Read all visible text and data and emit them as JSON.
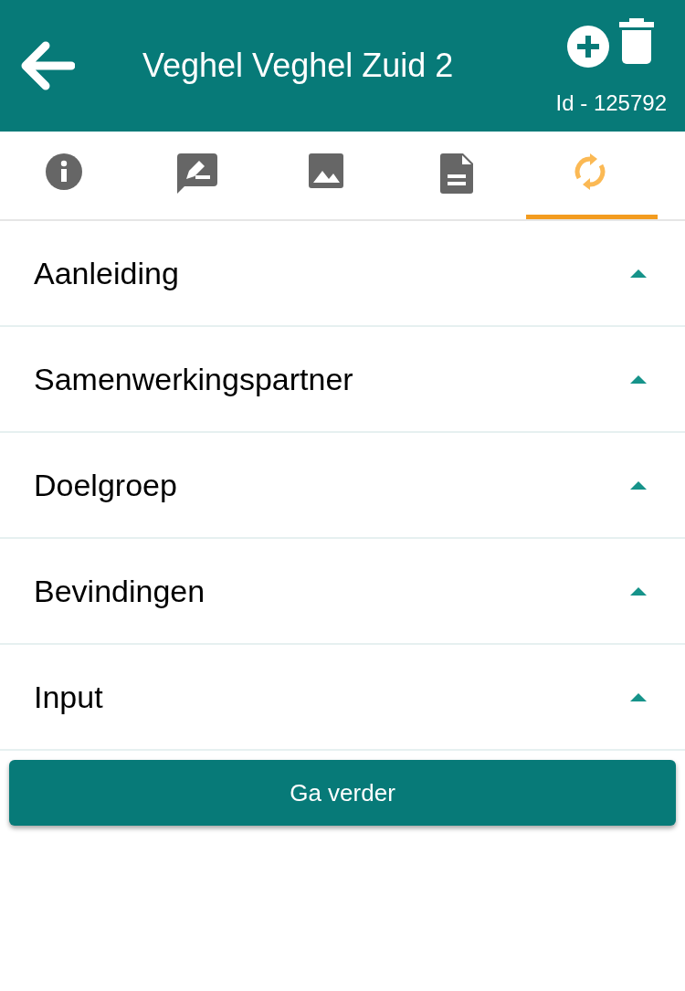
{
  "header": {
    "title": "Veghel Veghel Zuid 2",
    "id_label": "Id - 125792"
  },
  "tabs": [
    {
      "selected": false
    },
    {
      "selected": false
    },
    {
      "selected": false
    },
    {
      "selected": false
    },
    {
      "selected": true
    }
  ],
  "sections": [
    {
      "title": "Aanleiding"
    },
    {
      "title": "Samenwerkingspartner"
    },
    {
      "title": "Doelgroep"
    },
    {
      "title": "Bevindingen"
    },
    {
      "title": "Input"
    }
  ],
  "primary_button": "Ga verder"
}
